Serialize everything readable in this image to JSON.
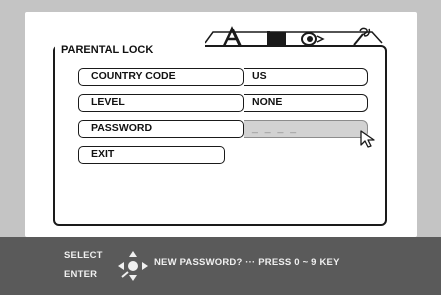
{
  "menu": {
    "title": "PARENTAL LOCK",
    "tabs": [
      "title-tab-icon",
      "display-tab-icon",
      "audio-tab-icon",
      "setup-wrench-icon"
    ]
  },
  "rows": [
    {
      "label": "COUNTRY CODE",
      "value": "US"
    },
    {
      "label": "LEVEL",
      "value": "NONE"
    },
    {
      "label": "PASSWORD",
      "value": "_ _ _ _"
    },
    {
      "label": "EXIT"
    }
  ],
  "footer": {
    "select_label": "SELECT",
    "enter_label": "ENTER",
    "message": "NEW PASSWORD? ··· PRESS 0 ~ 9 KEY"
  }
}
